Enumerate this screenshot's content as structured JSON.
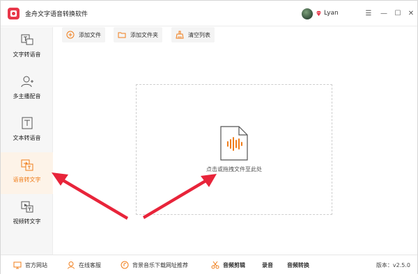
{
  "app": {
    "title": "金舟文字语音转换软件",
    "username": "Lyan"
  },
  "window_controls": {
    "menu": "☰",
    "minimize": "—",
    "maximize": "☐",
    "close": "✕"
  },
  "sidebar": {
    "items": [
      {
        "label": "文字转语音",
        "icon": "text-to-speech-icon",
        "active": false
      },
      {
        "label": "多主播配音",
        "icon": "multi-anchor-icon",
        "active": false
      },
      {
        "label": "文本转语音",
        "icon": "document-text-icon",
        "active": false
      },
      {
        "label": "语音转文字",
        "icon": "speech-to-text-icon",
        "active": true
      },
      {
        "label": "视频转文字",
        "icon": "video-to-text-icon",
        "active": false
      }
    ]
  },
  "toolbar": {
    "add_file": "添加文件",
    "add_folder": "添加文件夹",
    "clear_list": "清空列表"
  },
  "dropzone": {
    "hint": "点击或拖拽文件至此处"
  },
  "footer": {
    "website": "官方网站",
    "support": "在线客服",
    "music_download": "背景音乐下载网址推荐",
    "audio_cut": "音频剪辑",
    "record": "录音",
    "audio_convert": "音频转换",
    "version": "版本：v2.5.0"
  },
  "colors": {
    "accent": "#f07d1a",
    "arrow": "#e8243a",
    "brand": "#e8374a"
  }
}
